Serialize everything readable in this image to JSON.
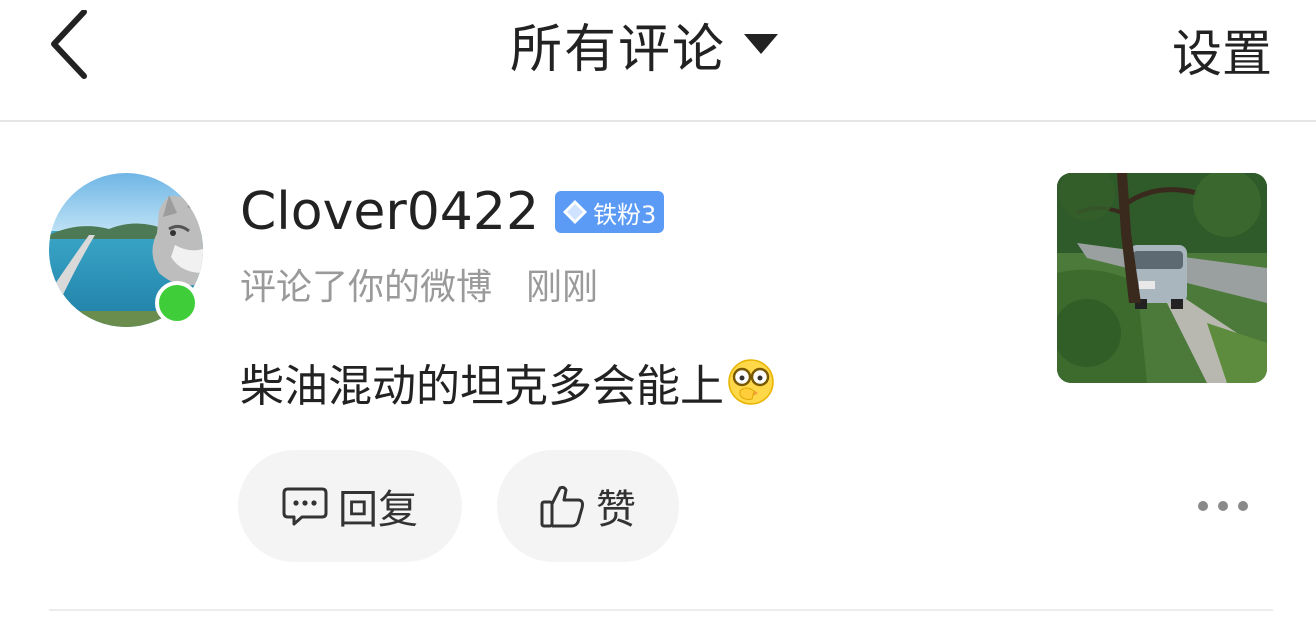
{
  "header": {
    "title": "所有评论",
    "settings_label": "设置"
  },
  "comment": {
    "username": "Clover0422",
    "badge": "铁粉3",
    "action": "评论了你的微博",
    "time": "刚刚",
    "text": "柴油混动的坦克多会能上",
    "reply_label": "回复",
    "like_label": "赞"
  },
  "colors": {
    "online": "#3fcd3a",
    "badge": "#5b9bf5"
  },
  "icons": {
    "back": "chevron-left-icon",
    "dropdown": "caret-down-icon",
    "reply": "comment-bubble-icon",
    "like": "thumbs-up-icon",
    "more": "ellipsis-icon"
  }
}
